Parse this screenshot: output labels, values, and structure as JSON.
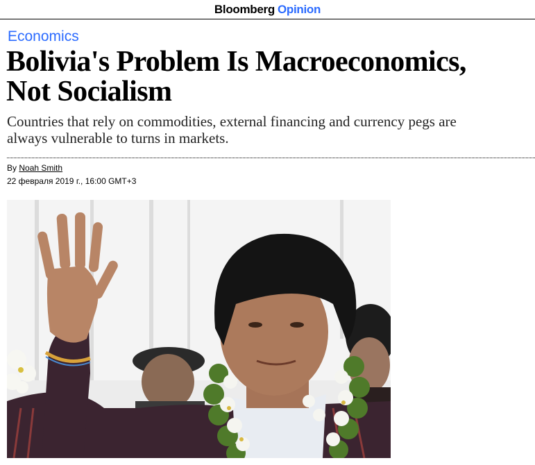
{
  "header": {
    "brand": "Bloomberg",
    "brand_section": "Opinion"
  },
  "article": {
    "section": "Economics",
    "headline_line1": "Bolivia's Problem Is Macroeconomics,",
    "headline_line2": "Not Socialism",
    "dek_line1": "Countries that rely on commodities, external financing and currency pegs are",
    "dek_line2": "always vulnerable to turns in markets.",
    "by_prefix": "By",
    "author": "Noah Smith",
    "date": "22 февраля 2019 г., 16:00 GMT+3"
  },
  "colors": {
    "accent": "#2b6bff",
    "text": "#000000"
  }
}
